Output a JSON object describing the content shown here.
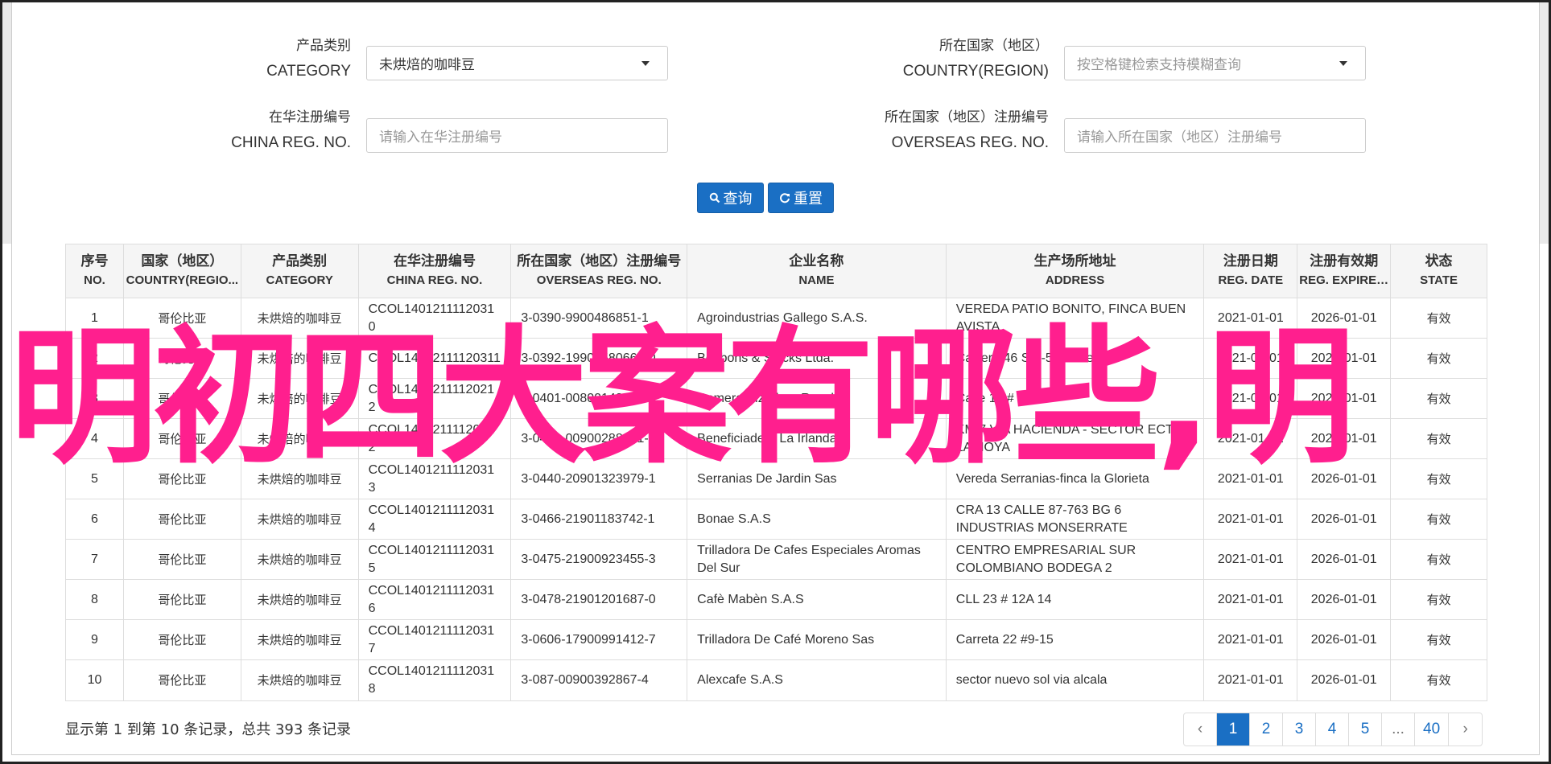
{
  "search": {
    "category_label_zh": "产品类别",
    "category_label_en": "CATEGORY",
    "category_value": "未烘焙的咖啡豆",
    "country_label_zh": "所在国家（地区）",
    "country_label_en": "COUNTRY(REGION)",
    "country_placeholder": "按空格键检索支持模糊查询",
    "china_reg_label_zh": "在华注册编号",
    "china_reg_label_en": "CHINA REG. NO.",
    "china_reg_placeholder": "请输入在华注册编号",
    "overseas_reg_label_zh": "所在国家（地区）注册编号",
    "overseas_reg_label_en": "OVERSEAS REG. NO.",
    "overseas_reg_placeholder": "请输入所在国家（地区）注册编号",
    "query_button": "查询",
    "reset_button": "重置"
  },
  "table": {
    "headers": [
      {
        "zh": "序号",
        "en": "NO."
      },
      {
        "zh": "国家（地区）",
        "en": "COUNTRY(REGIO..."
      },
      {
        "zh": "产品类别",
        "en": "CATEGORY"
      },
      {
        "zh": "在华注册编号",
        "en": "CHINA REG. NO."
      },
      {
        "zh": "所在国家（地区）注册编号",
        "en": "OVERSEAS REG. NO."
      },
      {
        "zh": "企业名称",
        "en": "NAME"
      },
      {
        "zh": "生产场所地址",
        "en": "ADDRESS"
      },
      {
        "zh": "注册日期",
        "en": "REG. DATE"
      },
      {
        "zh": "注册有效期",
        "en": "REG. EXPIRE ..."
      },
      {
        "zh": "状态",
        "en": "STATE"
      }
    ],
    "rows": [
      {
        "no": "1",
        "country": "哥伦比亚",
        "category": "未烘焙的咖啡豆",
        "china_reg": "CCOL14012111120310",
        "overseas_reg": "3-0390-9900486851-1",
        "name": "Agroindustrias Gallego S.A.S.",
        "address": "VEREDA PATIO BONITO, FINCA BUEN AVISTA",
        "reg_date": "2021-01-01",
        "expire": "2026-01-01",
        "state": "有效"
      },
      {
        "no": "2",
        "country": "哥伦比亚",
        "category": "未烘焙的咖啡豆",
        "china_reg": "CCOL14012111120311",
        "overseas_reg": "3-0392-19900580660-0",
        "name": "Bonbons & Stycks Ltda.",
        "address": "Carrera 46 Sur-50 Bodega 5",
        "reg_date": "2021-01-01",
        "expire": "2026-01-01",
        "state": "有效"
      },
      {
        "no": "3",
        "country": "哥伦比亚",
        "category": "未烘焙的咖啡豆",
        "china_reg": "CCOL14012111120212",
        "overseas_reg": "3-0401-00800148312-5",
        "name": "Comercializadora Royal",
        "address": "Calle 10 # 6-48",
        "reg_date": "2021-01-01",
        "expire": "2026-01-01",
        "state": "有效"
      },
      {
        "no": "4",
        "country": "哥伦比亚",
        "category": "未烘焙的咖啡豆",
        "china_reg": "CCOL14012111120312",
        "overseas_reg": "3-0428-00900288861-9",
        "name": "Beneficiadero La Irlanda",
        "address": "KM 7 VIA HACIENDA - SECTOR ECTOR LA HOYA",
        "reg_date": "2021-01-01",
        "expire": "2026-01-01",
        "state": "有效"
      },
      {
        "no": "5",
        "country": "哥伦比亚",
        "category": "未烘焙的咖啡豆",
        "china_reg": "CCOL14012111120313",
        "overseas_reg": "3-0440-20901323979-1",
        "name": "Serranias De Jardin Sas",
        "address": "Vereda Serranias-finca la Glorieta",
        "reg_date": "2021-01-01",
        "expire": "2026-01-01",
        "state": "有效"
      },
      {
        "no": "6",
        "country": "哥伦比亚",
        "category": "未烘焙的咖啡豆",
        "china_reg": "CCOL14012111120314",
        "overseas_reg": "3-0466-21901183742-1",
        "name": "Bonae S.A.S",
        "address": "CRA 13 CALLE 87-763 BG 6 INDUSTRIAS MONSERRATE",
        "reg_date": "2021-01-01",
        "expire": "2026-01-01",
        "state": "有效"
      },
      {
        "no": "7",
        "country": "哥伦比亚",
        "category": "未烘焙的咖啡豆",
        "china_reg": "CCOL14012111120315",
        "overseas_reg": "3-0475-21900923455-3",
        "name": "Trilladora De Cafes Especiales Aromas Del Sur",
        "address": "CENTRO EMPRESARIAL SUR COLOMBIANO BODEGA 2",
        "reg_date": "2021-01-01",
        "expire": "2026-01-01",
        "state": "有效"
      },
      {
        "no": "8",
        "country": "哥伦比亚",
        "category": "未烘焙的咖啡豆",
        "china_reg": "CCOL14012111120316",
        "overseas_reg": "3-0478-21901201687-0",
        "name": "Cafè Mabèn S.A.S",
        "address": "CLL 23 # 12A 14",
        "reg_date": "2021-01-01",
        "expire": "2026-01-01",
        "state": "有效"
      },
      {
        "no": "9",
        "country": "哥伦比亚",
        "category": "未烘焙的咖啡豆",
        "china_reg": "CCOL14012111120317",
        "overseas_reg": "3-0606-17900991412-7",
        "name": "Trilladora De Café Moreno Sas",
        "address": "Carreta 22 #9-15",
        "reg_date": "2021-01-01",
        "expire": "2026-01-01",
        "state": "有效"
      },
      {
        "no": "10",
        "country": "哥伦比亚",
        "category": "未烘焙的咖啡豆",
        "china_reg": "CCOL14012111120318",
        "overseas_reg": "3-087-00900392867-4",
        "name": "Alexcafe S.A.S",
        "address": "sector nuevo sol via alcala",
        "reg_date": "2021-01-01",
        "expire": "2026-01-01",
        "state": "有效"
      }
    ]
  },
  "footer": {
    "summary": "显示第 1 到第 10 条记录，总共 393 条记录"
  },
  "pagination": {
    "prev": "‹",
    "pages": [
      "1",
      "2",
      "3",
      "4",
      "5",
      "...",
      "40"
    ],
    "next": "›",
    "current": "1"
  },
  "overlay_text": "明初四大案有哪些,明",
  "colors": {
    "primary": "#1a6fc4",
    "overlay": "#ff1f8e"
  }
}
